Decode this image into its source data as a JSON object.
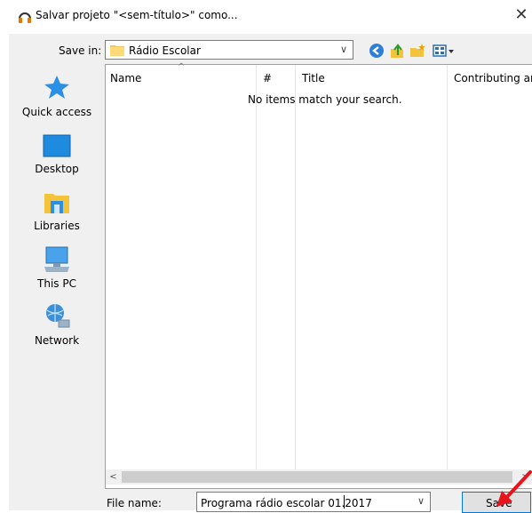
{
  "window": {
    "title": "Salvar projeto \"<sem-título>\" como...",
    "close_glyph": "✕"
  },
  "toolbar": {
    "save_in_label": "Save in:",
    "save_in_value": "Rádio Escolar",
    "chevron_glyph": "∨",
    "icons": [
      "back-icon",
      "up-folder-icon",
      "new-folder-icon",
      "view-menu-icon"
    ]
  },
  "places": [
    {
      "label": "Quick access",
      "icon": "quick-access-star-icon"
    },
    {
      "label": "Desktop",
      "icon": "desktop-icon"
    },
    {
      "label": "Libraries",
      "icon": "libraries-icon"
    },
    {
      "label": "This PC",
      "icon": "this-pc-icon"
    },
    {
      "label": "Network",
      "icon": "network-icon"
    }
  ],
  "list": {
    "columns": [
      "Name",
      "#",
      "Title",
      "Contributing ar"
    ],
    "empty_message": "No items match your search.",
    "sort_glyph": "^"
  },
  "scrollbar": {
    "left_glyph": "<",
    "right_glyph": ">"
  },
  "footer": {
    "file_name_label": "File name:",
    "file_name_value": "Programa rádio escolar 01.2017",
    "chevron_glyph": "∨",
    "save_label": "Save"
  },
  "colors": {
    "dialog_bg": "#f0f0f0",
    "accent": "#0078d7",
    "annotation_arrow": "#e8141b"
  }
}
